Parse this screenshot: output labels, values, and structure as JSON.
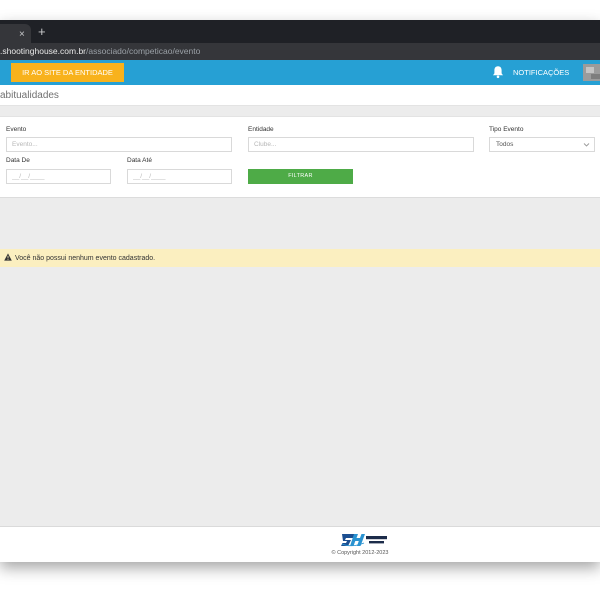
{
  "browser": {
    "tab_close": "×",
    "new_tab": "+",
    "url_host": ".shootinghouse.com.br",
    "url_path": "/associado/competicao/evento"
  },
  "header": {
    "site_button": "IR AO SITE DA ENTIDADE",
    "notifications": "NOTIFICAÇÕES"
  },
  "page": {
    "title": "abitualidades"
  },
  "filters": {
    "evento_label": "Evento",
    "evento_placeholder": "Evento...",
    "entidade_label": "Entidade",
    "entidade_placeholder": "Clube...",
    "tipo_label": "Tipo Evento",
    "tipo_value": "Todos",
    "data_de_label": "Data De",
    "data_de_placeholder": "__/__/____",
    "data_ate_label": "Data Até",
    "data_ate_placeholder": "__/__/____",
    "filter_button": "FILTRAR"
  },
  "alert": {
    "text": "Você não possui nenhum evento cadastrado."
  },
  "footer": {
    "logo_text": "SHOOTING HOUSE",
    "copyright": "© Copyright 2012-2023"
  },
  "colors": {
    "header_bg": "#26a0d4",
    "site_button_bg": "#f8b21c",
    "filter_button_bg": "#4eab47",
    "alert_bg": "#fbefc0"
  },
  "icons": {
    "notifications": "bell-icon",
    "alert": "warning-triangle-icon",
    "select": "chevron-down-icon"
  }
}
